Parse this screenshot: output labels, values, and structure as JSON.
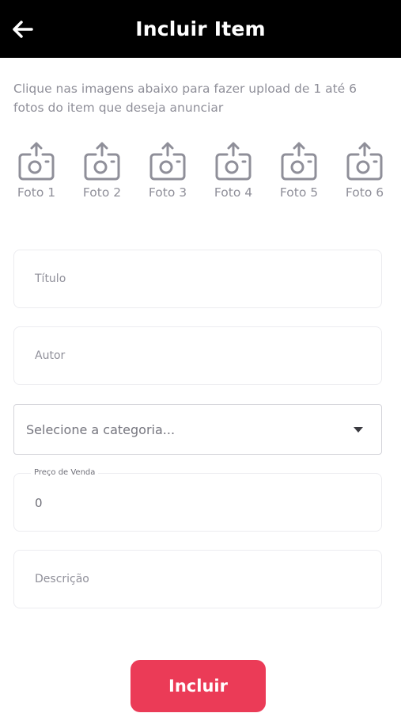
{
  "header": {
    "title": "Incluir Item",
    "back_icon": "arrow-left-icon"
  },
  "instructions": "Clique nas imagens abaixo para fazer upload de 1 até 6 fotos do item que deseja anunciar",
  "photos": [
    {
      "label": "Foto 1",
      "icon": "camera-upload-icon"
    },
    {
      "label": "Foto 2",
      "icon": "camera-upload-icon"
    },
    {
      "label": "Foto 3",
      "icon": "camera-upload-icon"
    },
    {
      "label": "Foto 4",
      "icon": "camera-upload-icon"
    },
    {
      "label": "Foto 5",
      "icon": "camera-upload-icon"
    },
    {
      "label": "Foto 6",
      "icon": "camera-upload-icon"
    }
  ],
  "form": {
    "titulo_placeholder": "Título",
    "autor_placeholder": "Autor",
    "categoria_selected": "Selecione a categoria...",
    "preco_label": "Preço de Venda",
    "preco_value": "0",
    "descricao_placeholder": "Descrição"
  },
  "submit_label": "Incluir",
  "colors": {
    "header_bg": "#000000",
    "accent": "#eb3b57",
    "muted_text": "#8f8f99"
  }
}
